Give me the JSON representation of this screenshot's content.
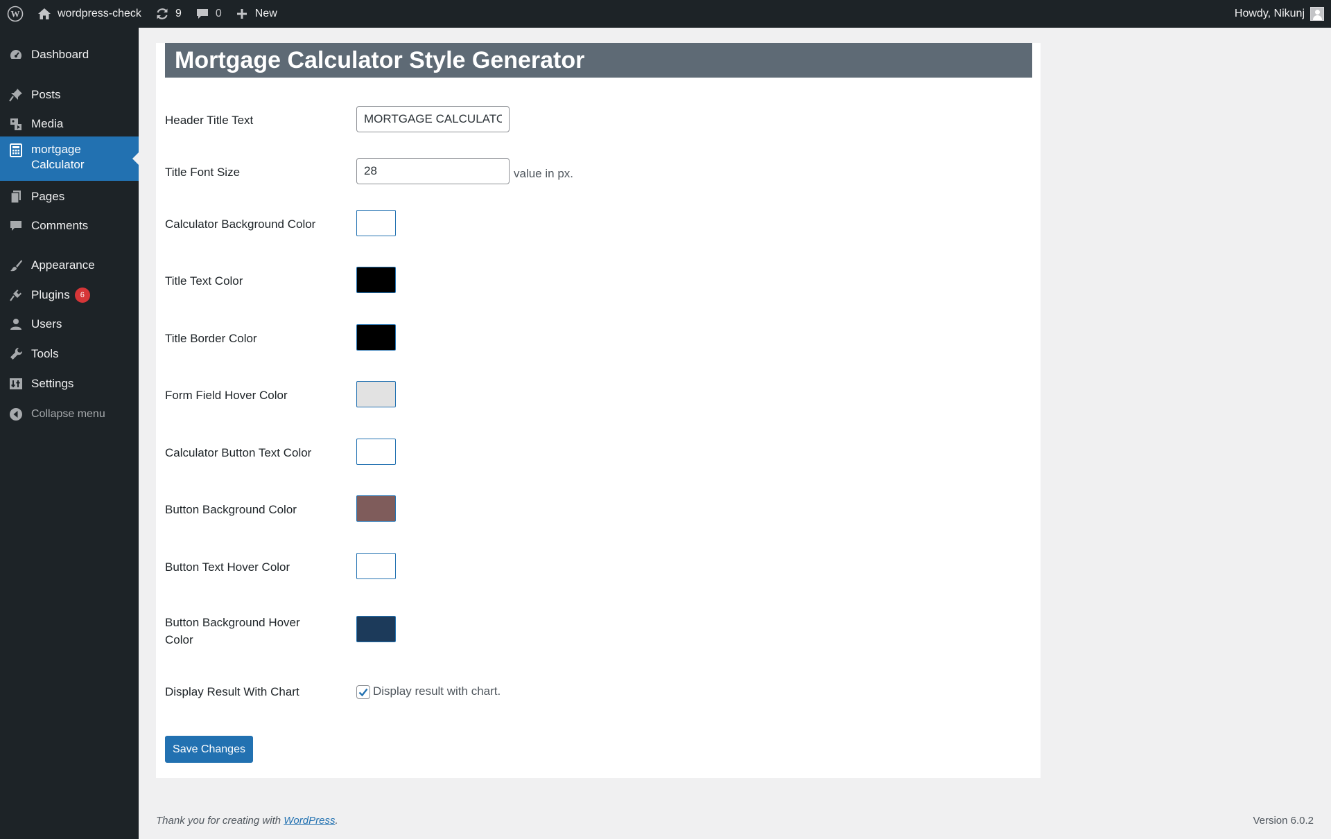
{
  "admin_bar": {
    "site_name": "wordpress-check",
    "updates_count": "9",
    "comments_count": "0",
    "new_label": "New",
    "howdy": "Howdy, Nikunj"
  },
  "sidebar": {
    "items": [
      {
        "label": "Dashboard",
        "icon": "dashboard-icon"
      },
      {
        "label": "Posts",
        "icon": "pin-icon"
      },
      {
        "label": "Media",
        "icon": "media-icon"
      },
      {
        "label": "mortgage",
        "label2": "Calculator",
        "icon": "calculator-icon",
        "active": true
      },
      {
        "label": "Pages",
        "icon": "pages-icon"
      },
      {
        "label": "Comments",
        "icon": "comments-icon"
      },
      {
        "label": "Appearance",
        "icon": "paintbrush-icon"
      },
      {
        "label": "Plugins",
        "icon": "plugins-icon",
        "badge": "6"
      },
      {
        "label": "Users",
        "icon": "users-icon"
      },
      {
        "label": "Tools",
        "icon": "wrench-icon"
      },
      {
        "label": "Settings",
        "icon": "settings-icon"
      }
    ],
    "collapse_label": "Collapse menu"
  },
  "page": {
    "title": "Mortgage Calculator Style Generator",
    "fields": {
      "header_title_text": {
        "label": "Header Title Text",
        "value": "MORTGAGE CALCULATOR"
      },
      "title_font_size": {
        "label": "Title Font Size",
        "value": "28",
        "hint": "value in px."
      },
      "calculator_bg_color": {
        "label": "Calculator Background Color",
        "color": "#ffffff"
      },
      "title_text_color": {
        "label": "Title Text Color",
        "color": "#000000"
      },
      "title_border_color": {
        "label": "Title Border Color",
        "color": "#000000"
      },
      "form_field_hover_color": {
        "label": "Form Field Hover Color",
        "color": "#e2e2e2"
      },
      "calc_button_text_color": {
        "label": "Calculator Button Text Color",
        "color": "#ffffff"
      },
      "button_bg_color": {
        "label": "Button Background Color",
        "color": "#7f5c5b"
      },
      "button_text_hover_color": {
        "label": "Button Text Hover Color",
        "color": "#ffffff"
      },
      "button_bg_hover_color": {
        "label": "Button Background Hover",
        "label2": "Color",
        "color": "#1c3a5a"
      },
      "display_chart": {
        "label": "Display Result With Chart",
        "checkbox_label": "Display result with chart.",
        "checked": true
      }
    },
    "save_label": "Save Changes"
  },
  "footer": {
    "thanks_prefix": "Thank you for creating with ",
    "thanks_link": "WordPress",
    "thanks_suffix": ".",
    "version": "Version 6.0.2"
  },
  "colors": {
    "admin_bar_bg": "#1d2327",
    "accent": "#2271b1",
    "header_bg": "#5e6a75",
    "badge": "#d63638"
  }
}
